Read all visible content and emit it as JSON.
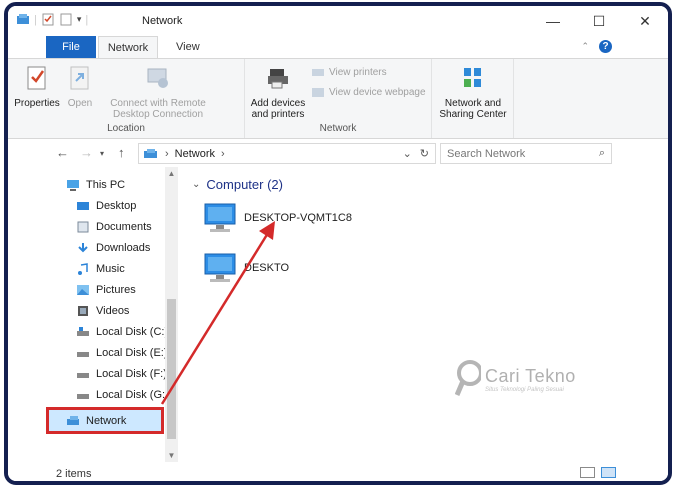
{
  "window": {
    "title": "Network",
    "controls": {
      "minimize": "—",
      "maximize": "☐",
      "close": "✕"
    }
  },
  "ribbon_tabs": [
    {
      "label": "File"
    },
    {
      "label": "Network"
    },
    {
      "label": "View"
    }
  ],
  "ribbon": {
    "location_group": {
      "label": "Location",
      "properties": "Properties",
      "open": "Open",
      "connect_line1": "Connect with Remote",
      "connect_line2": "Desktop Connection"
    },
    "network_group": {
      "label": "Network",
      "add_devices_line1": "Add devices",
      "add_devices_line2": "and printers",
      "view_printers": "View printers",
      "view_device_webpage": "View device webpage"
    },
    "nsc": {
      "line1": "Network and",
      "line2": "Sharing Center"
    }
  },
  "address": {
    "path": "Network",
    "search_placeholder": "Search Network"
  },
  "nav_pane": {
    "items": [
      {
        "label": "This PC",
        "icon": "pc-icon"
      },
      {
        "label": "Desktop",
        "icon": "desktop-icon"
      },
      {
        "label": "Documents",
        "icon": "documents-icon"
      },
      {
        "label": "Downloads",
        "icon": "downloads-icon"
      },
      {
        "label": "Music",
        "icon": "music-icon"
      },
      {
        "label": "Pictures",
        "icon": "pictures-icon"
      },
      {
        "label": "Videos",
        "icon": "videos-icon"
      },
      {
        "label": "Local Disk (C:)",
        "icon": "disk-icon"
      },
      {
        "label": "Local Disk (E:)",
        "icon": "disk-icon"
      },
      {
        "label": "Local Disk (F:)",
        "icon": "disk-icon"
      },
      {
        "label": "Local Disk (G:)",
        "icon": "disk-icon"
      },
      {
        "label": "Network",
        "icon": "network-icon"
      }
    ]
  },
  "content": {
    "group_header": "Computer (2)",
    "computers": [
      {
        "name": "DESKTOP-VQMT1C8"
      },
      {
        "name": "DESKTO"
      }
    ]
  },
  "watermark": {
    "title": "Cari Tekno",
    "subtitle": "Situs Teknologi Paling Sesuai"
  },
  "status": {
    "item_count": "2 items"
  },
  "colors": {
    "accent": "#1a66c2",
    "highlight_border": "#d42a2a",
    "frame": "#142050"
  }
}
